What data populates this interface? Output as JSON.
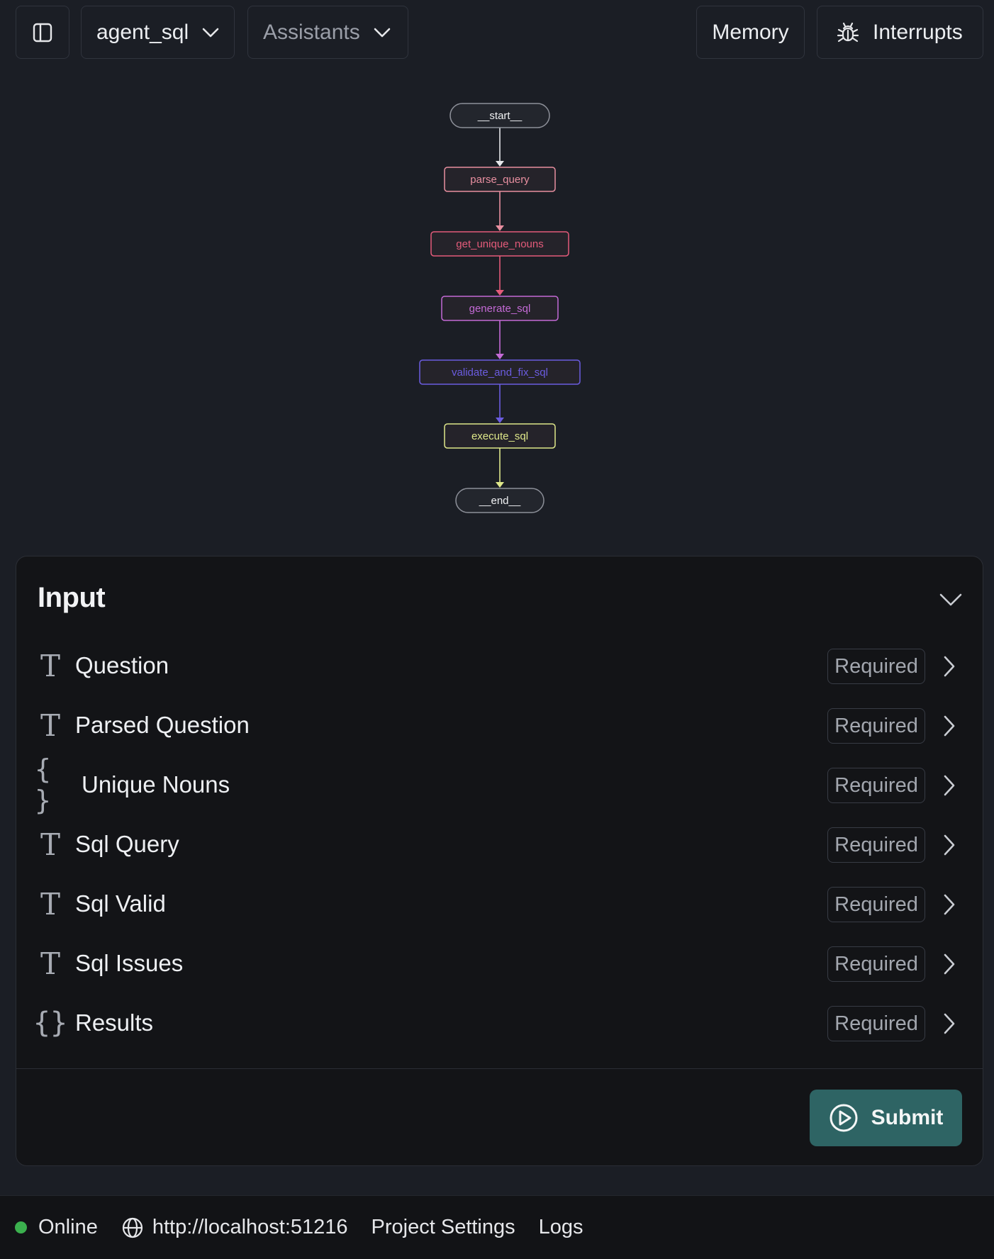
{
  "toolbar": {
    "sidebar_icon": "sidebar-panel-icon",
    "graph_select": "agent_sql",
    "assistants_select": "Assistants",
    "memory_label": "Memory",
    "interrupts_label": "Interrupts",
    "interrupts_icon": "bug-icon"
  },
  "graph": {
    "nodes": [
      {
        "id": "__start__",
        "label": "__start__",
        "shape": "pill",
        "color": "#d9dbe0"
      },
      {
        "id": "parse_query",
        "label": "parse_query",
        "shape": "rect",
        "color": "#e88fa0"
      },
      {
        "id": "get_unique_nouns",
        "label": "get_unique_nouns",
        "shape": "rect",
        "color": "#e45b7a"
      },
      {
        "id": "generate_sql",
        "label": "generate_sql",
        "shape": "rect",
        "color": "#c46ad6"
      },
      {
        "id": "validate_and_fix_sql",
        "label": "validate_and_fix_sql",
        "shape": "rect",
        "color": "#6b5ce0"
      },
      {
        "id": "execute_sql",
        "label": "execute_sql",
        "shape": "rect",
        "color": "#dfe88a"
      },
      {
        "id": "__end__",
        "label": "__end__",
        "shape": "pill",
        "color": "#d9dbe0"
      }
    ]
  },
  "input_panel": {
    "title": "Input",
    "badge": "Required",
    "fields": [
      {
        "label": "Question",
        "type": "text",
        "icon": "T"
      },
      {
        "label": "Parsed Question",
        "type": "text",
        "icon": "T"
      },
      {
        "label": "Unique Nouns",
        "type": "object",
        "icon": "{ }"
      },
      {
        "label": "Sql Query",
        "type": "text",
        "icon": "T"
      },
      {
        "label": "Sql Valid",
        "type": "text",
        "icon": "T"
      },
      {
        "label": "Sql Issues",
        "type": "text",
        "icon": "T"
      },
      {
        "label": "Results",
        "type": "object",
        "icon": "{}"
      }
    ],
    "submit_label": "Submit"
  },
  "footer": {
    "status": "Online",
    "status_color": "#3bb04e",
    "url": "http://localhost:51216",
    "project_settings": "Project Settings",
    "logs": "Logs"
  }
}
